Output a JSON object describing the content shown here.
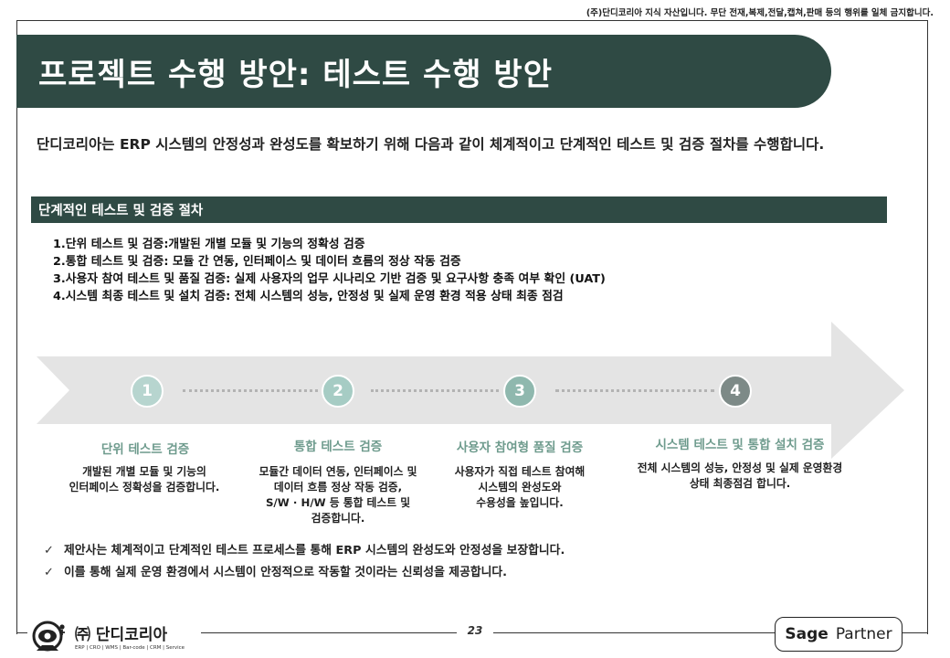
{
  "copyright": "(주)단디코리아 지식 자산입니다. 무단 전재,복제,전달,캡쳐,판매 등의 행위를 일체 금지합니다.",
  "title": "프로젝트 수행 방안: 테스트 수행 방안",
  "intro": "단디코리아는 ERP 시스템의 안정성과 완성도를 확보하기 위해 다음과 같이 체계적이고 단계적인 테스트 및 검증 절차를 수행합니다.",
  "section_title": "단계적인 테스트 및 검증 절차",
  "steps": [
    "1.단위 테스트 및 검증:개발된 개별 모듈 및 기능의 정확성 검증",
    "2.통합 테스트 및 검증: 모듈 간 연동, 인터페이스 및 데이터 흐름의 정상 작동 검증",
    "3.사용자 참여 테스트 및 품질 검증: 실제 사용자의 업무 시나리오 기반 검증 및 요구사항 충족 여부 확인 (UAT)",
    "4.시스템 최종 테스트 및 설치 검증: 전체 시스템의 성능, 안정성 및 실제 운영 환경 적용 상태 최종 점검"
  ],
  "stages": [
    {
      "num": "1",
      "title": "단위 테스트 검증",
      "desc": "개발된 개별 모듈 및 기능의\n인터페이스 정확성을 검증합니다.",
      "color": "#b7d5cf"
    },
    {
      "num": "2",
      "title": "통합 테스트 검증",
      "desc": "모듈간 데이터 연동, 인터페이스 및\n데이터 흐름 정상 작동 검증,\nS/W · H/W 등 통합 테스트 및\n검증합니다.",
      "color": "#a6ccc4"
    },
    {
      "num": "3",
      "title": "사용자 참여형 품질 검증",
      "desc": "사용자가 직접 테스트 참여해\n시스템의 완성도와\n수용성을 높입니다.",
      "color": "#8fb8ae"
    },
    {
      "num": "4",
      "title": "시스템 테스트 및 통합 설치 검증",
      "desc": "전체 시스템의 성능, 안정성 및 실제 운영환경\n상태 최종점검 합니다.",
      "color": "#7d8a87"
    }
  ],
  "notes": [
    "제안사는 체계적이고 단계적인 테스트 프로세스를 통해 ERP 시스템의 완성도와 안정성을 보장합니다.",
    "이를 통해 실제 운영 환경에서 시스템이 안정적으로 작동할 것이라는 신뢰성을 제공합니다."
  ],
  "check_icon": "✓",
  "logo": {
    "name": "㈜ 단디코리아",
    "tagline": "ERP | CRO | WMS | Bar-code | CRM | Service",
    "icon": "eye-robot-icon"
  },
  "page_number": "23",
  "partner": {
    "brand": "Sage",
    "label": "Partner"
  },
  "colors": {
    "primary": "#2f4a44",
    "accent_text": "#6e9b8d",
    "arrow": "#e4e4e4"
  }
}
